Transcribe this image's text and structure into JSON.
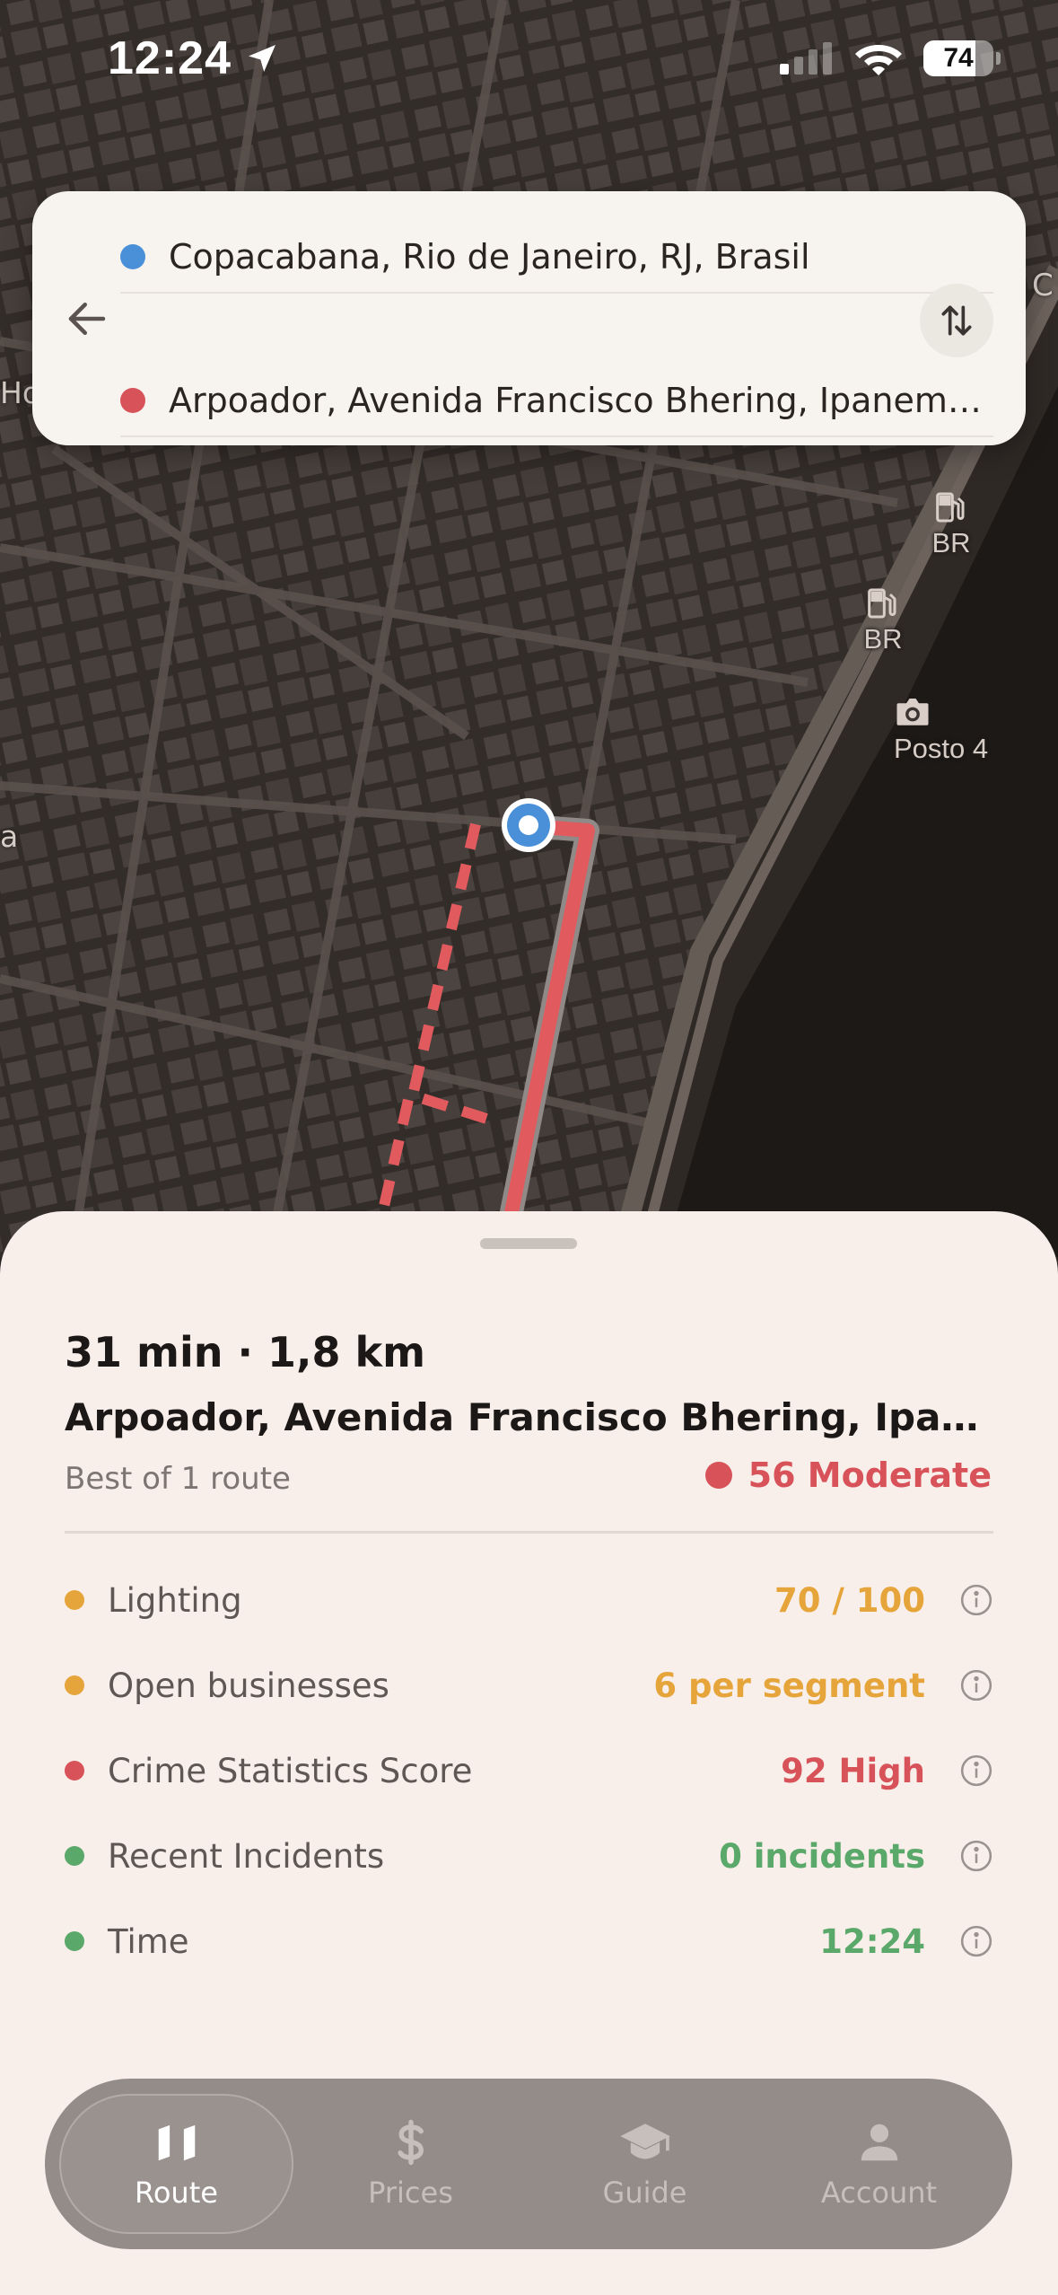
{
  "status_bar": {
    "time": "12:24",
    "battery_level": "74",
    "battery_fraction": 0.74
  },
  "search": {
    "origin": "Copacabana, Rio de Janeiro, RJ, Brasil",
    "destination": "Arpoador, Avenida Francisco Bhering, Ipanema, Ri…",
    "origin_color": "#4a90d9",
    "destination_color": "#d8525a"
  },
  "map": {
    "pois": [
      {
        "label": "BR",
        "icon": "fuel-pump-icon"
      },
      {
        "label": "BR",
        "icon": "fuel-pump-icon"
      },
      {
        "label": "Posto 4",
        "icon": "camera-icon"
      }
    ],
    "edge_labels": [
      "Ho",
      "C",
      "a"
    ],
    "route_color": "#e05a5e"
  },
  "route": {
    "summary": "31 min · 1,8 km",
    "destination": "Arpoador, Avenida Francisco Bhering, Ipanem…",
    "count_text": "Best of 1 route",
    "safety_text": "56 Moderate",
    "safety_color": "#d8525a"
  },
  "metrics": [
    {
      "label": "Lighting",
      "value": "70 / 100",
      "color": "#e5a53a"
    },
    {
      "label": "Open businesses",
      "value": "6 per segment",
      "color": "#e5a53a"
    },
    {
      "label": "Crime Statistics Score",
      "value": "92 High",
      "color": "#d8525a"
    },
    {
      "label": "Recent Incidents",
      "value": "0 incidents",
      "color": "#5aa86a"
    },
    {
      "label": "Time",
      "value": "12:24",
      "color": "#5aa86a"
    }
  ],
  "tabs": [
    {
      "label": "Route",
      "icon": "map-icon",
      "active": true
    },
    {
      "label": "Prices",
      "icon": "dollar-icon",
      "active": false
    },
    {
      "label": "Guide",
      "icon": "graduation-cap-icon",
      "active": false
    },
    {
      "label": "Account",
      "icon": "person-icon",
      "active": false
    }
  ]
}
